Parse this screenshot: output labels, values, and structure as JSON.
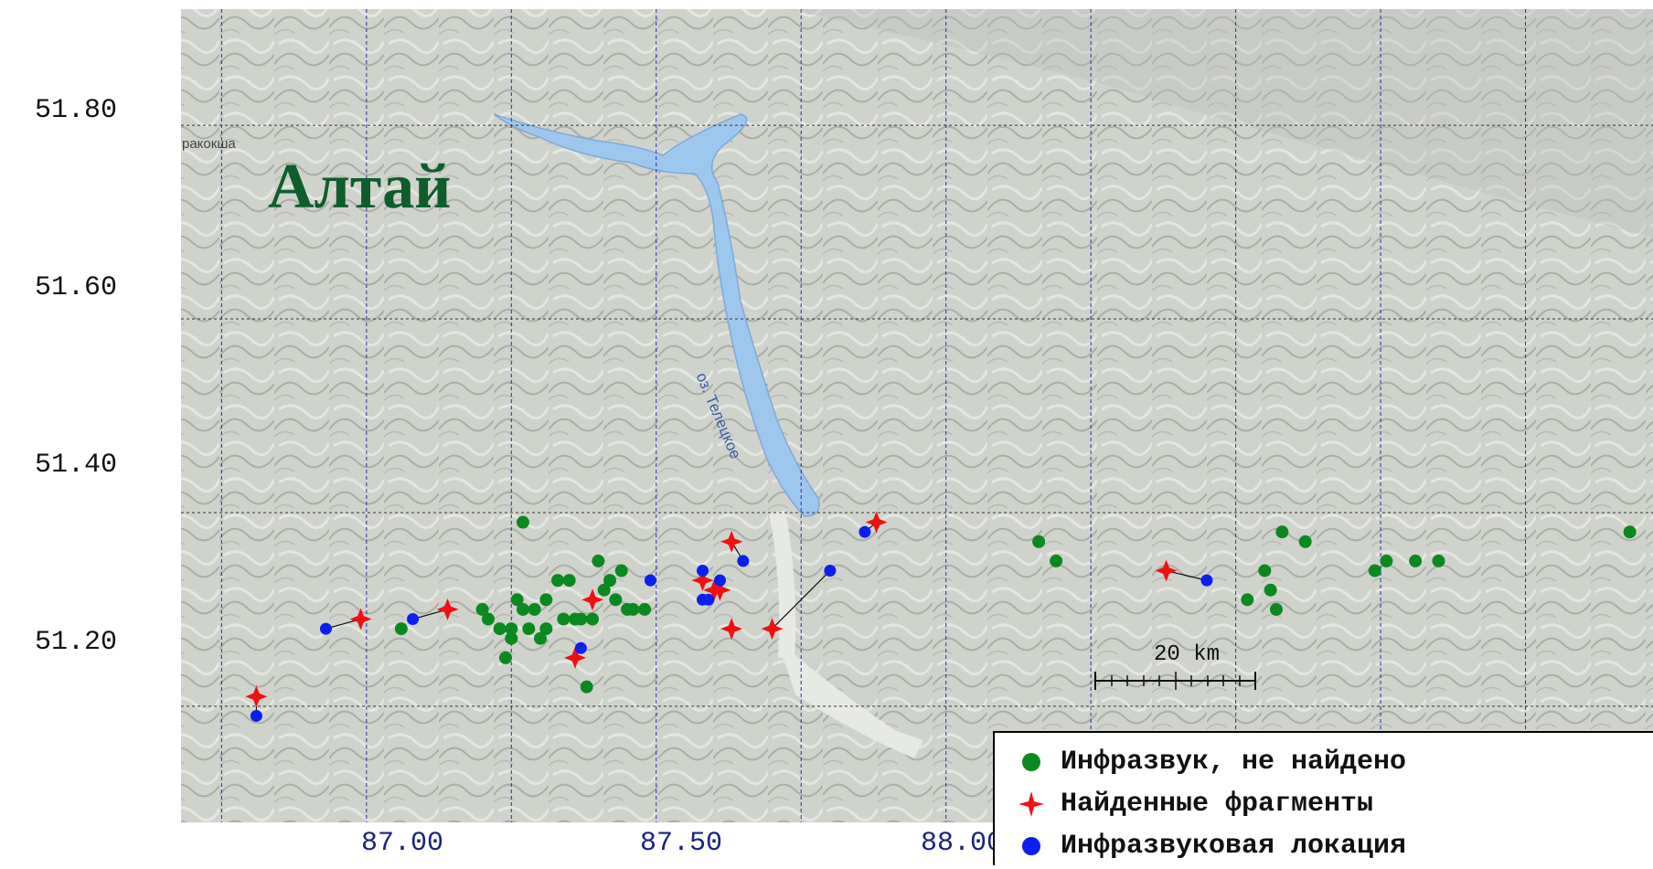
{
  "map": {
    "region_label": "Алтай",
    "town_label": "ракокша",
    "lake_label": "оз. Телецкое",
    "scale_label": "20 km",
    "colors": {
      "water": "#9ec7ee",
      "terrain": "#c9cdc6",
      "grid": "#2a2aa8",
      "not_found": "#0a8a1e",
      "fragments": "#ee1111",
      "location": "#0b1ff0"
    }
  },
  "axes": {
    "y_ticks": [
      "51.80",
      "51.60",
      "51.40",
      "51.20"
    ],
    "x_ticks": [
      "87.00",
      "87.50",
      "88.00"
    ]
  },
  "legend": {
    "items": [
      {
        "label": "Инфразвук, не найдено",
        "symbol": "green-circle"
      },
      {
        "label": "Найденные фрагменты",
        "symbol": "red-star"
      },
      {
        "label": "Инфразвуковая локация",
        "symbol": "blue-circle"
      }
    ]
  },
  "chart_data": {
    "type": "scatter",
    "xlim": [
      86.68,
      89.22
    ],
    "ylim": [
      51.08,
      51.92
    ],
    "grid": true,
    "series": [
      {
        "name": "Инфразвук, не найдено",
        "marker": "circle",
        "color": "#0a8a1e",
        "points": [
          [
            87.06,
            51.28
          ],
          [
            87.2,
            51.3
          ],
          [
            87.21,
            51.29
          ],
          [
            87.23,
            51.28
          ],
          [
            87.24,
            51.25
          ],
          [
            87.25,
            51.27
          ],
          [
            87.25,
            51.28
          ],
          [
            87.26,
            51.31
          ],
          [
            87.27,
            51.3
          ],
          [
            87.27,
            51.39
          ],
          [
            87.28,
            51.28
          ],
          [
            87.29,
            51.3
          ],
          [
            87.3,
            51.27
          ],
          [
            87.31,
            51.28
          ],
          [
            87.31,
            51.31
          ],
          [
            87.33,
            51.33
          ],
          [
            87.34,
            51.29
          ],
          [
            87.35,
            51.33
          ],
          [
            87.36,
            51.29
          ],
          [
            87.37,
            51.29
          ],
          [
            87.38,
            51.22
          ],
          [
            87.39,
            51.29
          ],
          [
            87.4,
            51.35
          ],
          [
            87.41,
            51.32
          ],
          [
            87.42,
            51.33
          ],
          [
            87.43,
            51.31
          ],
          [
            87.44,
            51.34
          ],
          [
            87.45,
            51.3
          ],
          [
            87.46,
            51.3
          ],
          [
            87.48,
            51.3
          ],
          [
            88.16,
            51.37
          ],
          [
            88.19,
            51.35
          ],
          [
            88.52,
            51.31
          ],
          [
            88.55,
            51.34
          ],
          [
            88.56,
            51.32
          ],
          [
            88.57,
            51.3
          ],
          [
            88.58,
            51.38
          ],
          [
            88.62,
            51.37
          ],
          [
            88.74,
            51.34
          ],
          [
            88.76,
            51.35
          ],
          [
            88.81,
            51.35
          ],
          [
            88.85,
            51.35
          ],
          [
            89.18,
            51.38
          ]
        ]
      },
      {
        "name": "Найденные фрагменты",
        "marker": "star",
        "color": "#ee1111",
        "points": [
          [
            86.81,
            51.21
          ],
          [
            86.99,
            51.29
          ],
          [
            87.14,
            51.3
          ],
          [
            87.36,
            51.25
          ],
          [
            87.39,
            51.31
          ],
          [
            87.58,
            51.33
          ],
          [
            87.6,
            51.32
          ],
          [
            87.61,
            51.32
          ],
          [
            87.63,
            51.28
          ],
          [
            87.63,
            51.37
          ],
          [
            87.7,
            51.28
          ],
          [
            87.88,
            51.39
          ],
          [
            88.38,
            51.34
          ]
        ]
      },
      {
        "name": "Инфразвуковая локация",
        "marker": "circle",
        "color": "#0b1ff0",
        "points": [
          [
            86.81,
            51.19
          ],
          [
            86.93,
            51.28
          ],
          [
            87.08,
            51.29
          ],
          [
            87.37,
            51.26
          ],
          [
            87.49,
            51.33
          ],
          [
            87.58,
            51.34
          ],
          [
            87.58,
            51.31
          ],
          [
            87.59,
            51.31
          ],
          [
            87.61,
            51.33
          ],
          [
            87.65,
            51.35
          ],
          [
            87.8,
            51.34
          ],
          [
            87.86,
            51.38
          ],
          [
            88.45,
            51.33
          ]
        ]
      }
    ]
  }
}
